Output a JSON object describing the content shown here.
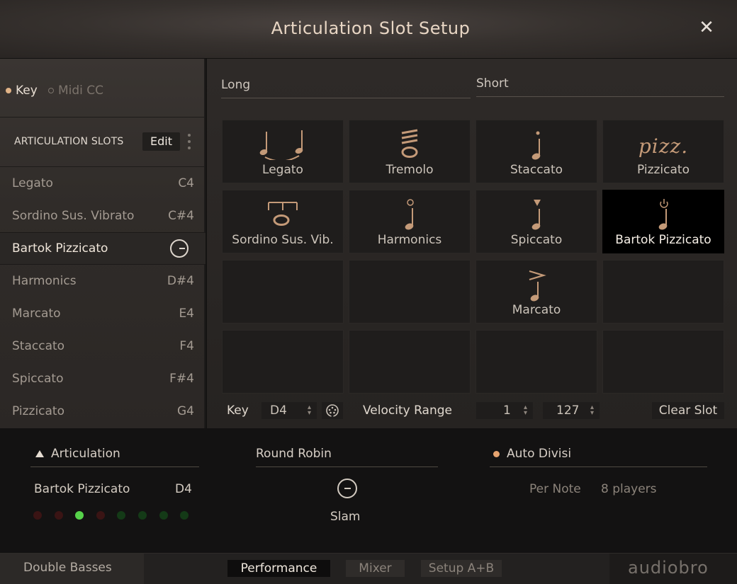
{
  "window": {
    "title": "Articulation Slot Setup",
    "close_glyph": "✕"
  },
  "trigger_mode": {
    "options": [
      "Key",
      "Midi CC"
    ],
    "selected": "Key"
  },
  "slots_panel": {
    "title": "ARTICULATION SLOTS",
    "edit_label": "Edit",
    "items": [
      {
        "name": "Legato",
        "key": "C4"
      },
      {
        "name": "Sordino Sus. Vibrato",
        "key": "C#4"
      },
      {
        "name": "Bartok Pizzicato",
        "key": "",
        "active": true
      },
      {
        "name": "Harmonics",
        "key": "D#4"
      },
      {
        "name": "Marcato",
        "key": "E4"
      },
      {
        "name": "Staccato",
        "key": "F4"
      },
      {
        "name": "Spiccato",
        "key": "F#4"
      },
      {
        "name": "Pizzicato",
        "key": "G4"
      }
    ]
  },
  "categories": {
    "long": "Long",
    "short": "Short"
  },
  "grid": [
    {
      "label": "Legato",
      "icon": "legato-icon"
    },
    {
      "label": "Tremolo",
      "icon": "tremolo-icon"
    },
    {
      "label": "Staccato",
      "icon": "staccato-icon"
    },
    {
      "label": "Pizzicato",
      "icon": "pizzicato-icon",
      "text": "pizz."
    },
    {
      "label": "Sordino Sus. Vib.",
      "icon": "sordino-icon"
    },
    {
      "label": "Harmonics",
      "icon": "harmonics-icon"
    },
    {
      "label": "Spiccato",
      "icon": "spiccato-icon"
    },
    {
      "label": "Bartok Pizzicato",
      "icon": "bartok-icon",
      "selected": true
    },
    {
      "label": ""
    },
    {
      "label": ""
    },
    {
      "label": "Marcato",
      "icon": "marcato-icon"
    },
    {
      "label": ""
    },
    {
      "label": ""
    },
    {
      "label": ""
    },
    {
      "label": ""
    },
    {
      "label": ""
    }
  ],
  "slot_settings": {
    "key_label": "Key",
    "key_value": "D4",
    "velocity_label": "Velocity Range",
    "velocity_min": "1",
    "velocity_max": "127",
    "clear_label": "Clear Slot"
  },
  "bottom": {
    "articulation": {
      "title": "Articulation",
      "name": "Bartok Pizzicato",
      "key": "D4",
      "leds": [
        "#3a1414",
        "#3a1414",
        "#56d14a",
        "#3a1414",
        "#143a17",
        "#143a17",
        "#143a17",
        "#143a17"
      ]
    },
    "round_robin": {
      "title": "Round Robin",
      "value": "Slam"
    },
    "auto_divisi": {
      "title": "Auto Divisi",
      "mode": "Per Note",
      "players": "8 players"
    }
  },
  "status_bar": {
    "instrument": "Double Basses",
    "tabs": [
      "Performance",
      "Mixer",
      "Setup A+B"
    ],
    "active_tab": "Performance",
    "brand": "audiobro"
  },
  "colors": {
    "accent": "#e0b387",
    "led_on": "#56d14a",
    "selected_cell": "#000000"
  }
}
